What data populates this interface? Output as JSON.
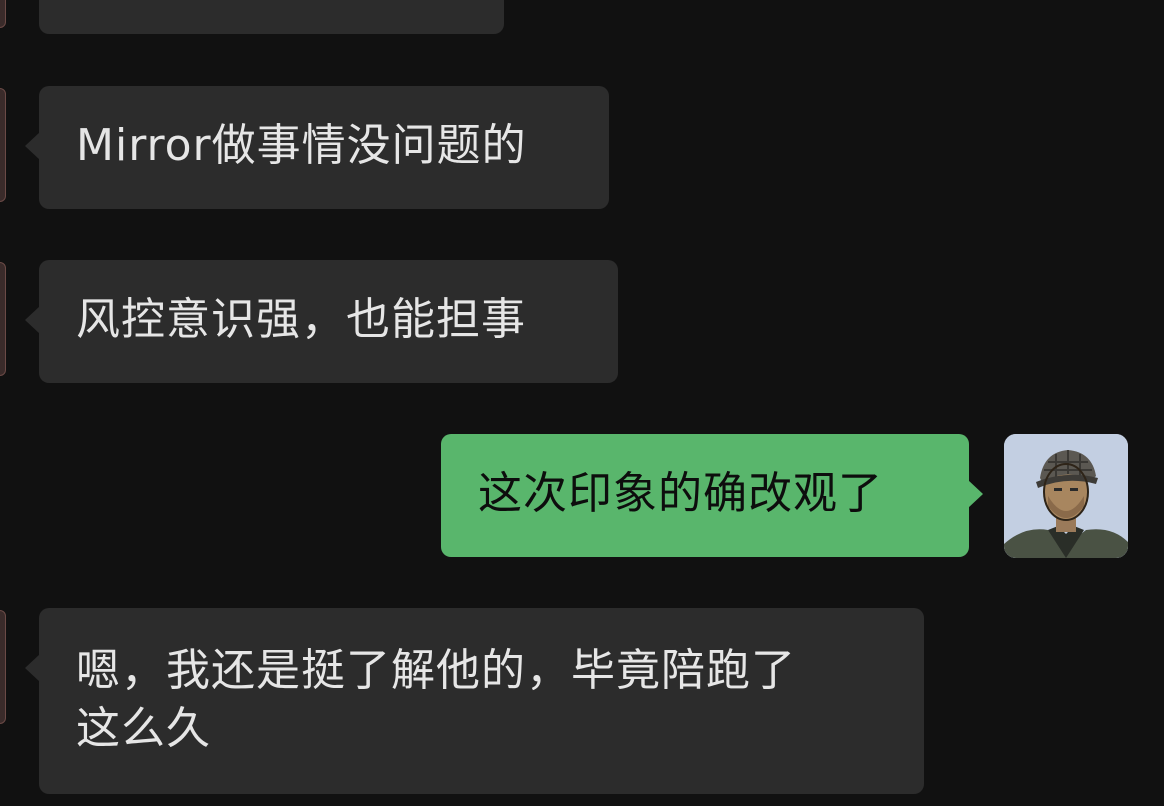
{
  "messages": [
    {
      "id": "m0",
      "direction": "received",
      "text": ""
    },
    {
      "id": "m1",
      "direction": "received",
      "text": "Mirror做事情没问题的"
    },
    {
      "id": "m2",
      "direction": "received",
      "text": "风控意识强，也能担事"
    },
    {
      "id": "m3",
      "direction": "sent",
      "text": "这次印象的确改观了"
    },
    {
      "id": "m4",
      "direction": "received",
      "text": "嗯，我还是挺了解他的，毕竟陪跑了\n这么久"
    }
  ],
  "colors": {
    "background": "#111111",
    "received_bubble": "#2c2c2c",
    "sent_bubble": "#59b66c",
    "received_text": "#e6e6e6",
    "sent_text": "#0d0d0d"
  },
  "icons": {
    "self_avatar": "user-avatar-illustration"
  }
}
